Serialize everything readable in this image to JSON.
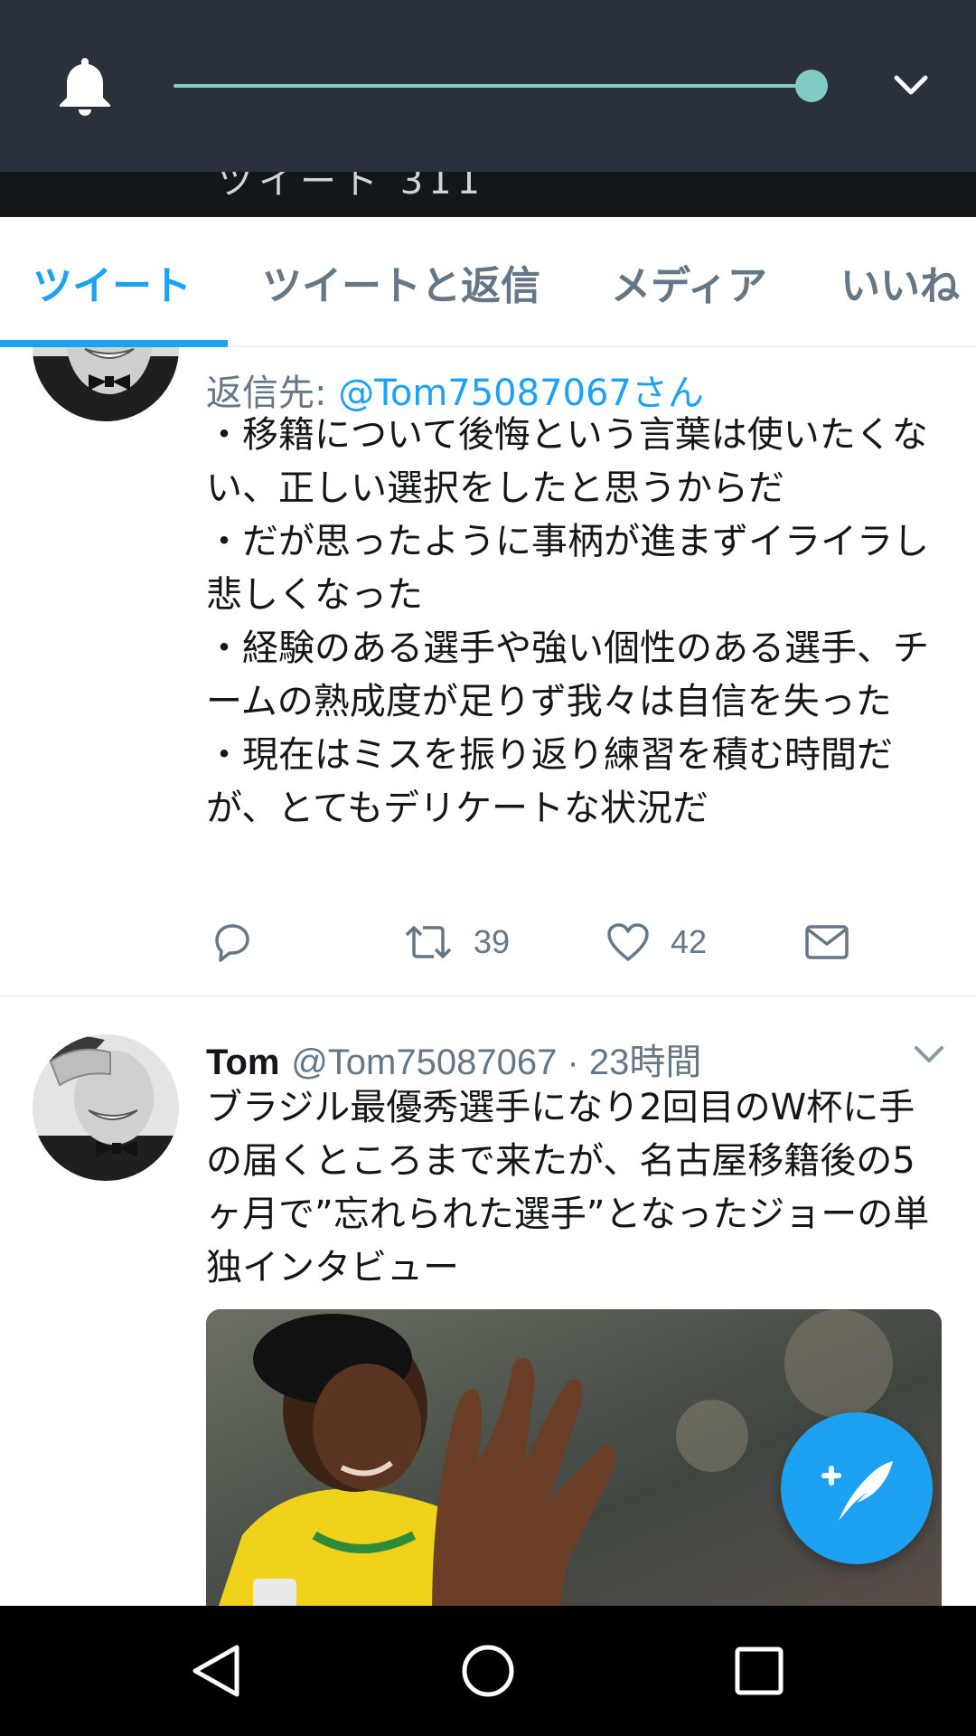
{
  "header": {
    "peek_text": "ツイート 311"
  },
  "volume": {
    "level": 0.98
  },
  "tabs": [
    {
      "label": "ツイート",
      "active": true
    },
    {
      "label": "ツイートと返信",
      "active": false
    },
    {
      "label": "メディア",
      "active": false
    },
    {
      "label": "いいね",
      "active": false
    }
  ],
  "tweets": [
    {
      "reply_prefix": "返信先: ",
      "reply_handle": "@Tom75087067さん",
      "text": "・移籍について後悔という言葉は使いたくない、正しい選択をしたと思うからだ\n・だが思ったように事柄が進まずイライラし悲しくなった\n・経験のある選手や強い個性のある選手、チームの熟成度が足りず我々は自信を失った\n・現在はミスを振り返り練習を積む時間だが、とてもデリケートな状況だ",
      "retweets": "39",
      "likes": "42"
    },
    {
      "name": "Tom",
      "handle": "@Tom75087067",
      "time": " · 23時間",
      "text": "ブラジル最優秀選手になり2回目のW杯に手の届くところまで来たが、名古屋移籍後の5ヶ月で”忘れられた選手”となったジョーの単独インタビュー"
    }
  ],
  "colors": {
    "accent": "#1da1f2",
    "overlay": "#2a313a",
    "slider": "#80cbc4"
  }
}
